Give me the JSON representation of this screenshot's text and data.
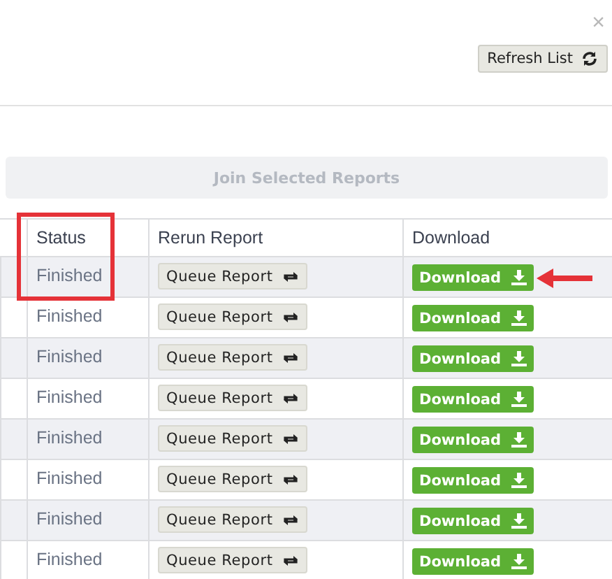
{
  "close": "×",
  "refresh_button": {
    "label": "Refresh List"
  },
  "join_button": {
    "label": "Join Selected Reports",
    "disabled": true
  },
  "table": {
    "columns": [
      "Status",
      "Rerun Report",
      "Download"
    ],
    "rows": [
      {
        "status": "Finished",
        "rerun": "Queue Report",
        "download": "Download"
      },
      {
        "status": "Finished",
        "rerun": "Queue Report",
        "download": "Download"
      },
      {
        "status": "Finished",
        "rerun": "Queue Report",
        "download": "Download"
      },
      {
        "status": "Finished",
        "rerun": "Queue Report",
        "download": "Download"
      },
      {
        "status": "Finished",
        "rerun": "Queue Report",
        "download": "Download"
      },
      {
        "status": "Finished",
        "rerun": "Queue Report",
        "download": "Download"
      },
      {
        "status": "Finished",
        "rerun": "Queue Report",
        "download": "Download"
      },
      {
        "status": "Finished",
        "rerun": "Queue Report",
        "download": "Download"
      }
    ]
  }
}
